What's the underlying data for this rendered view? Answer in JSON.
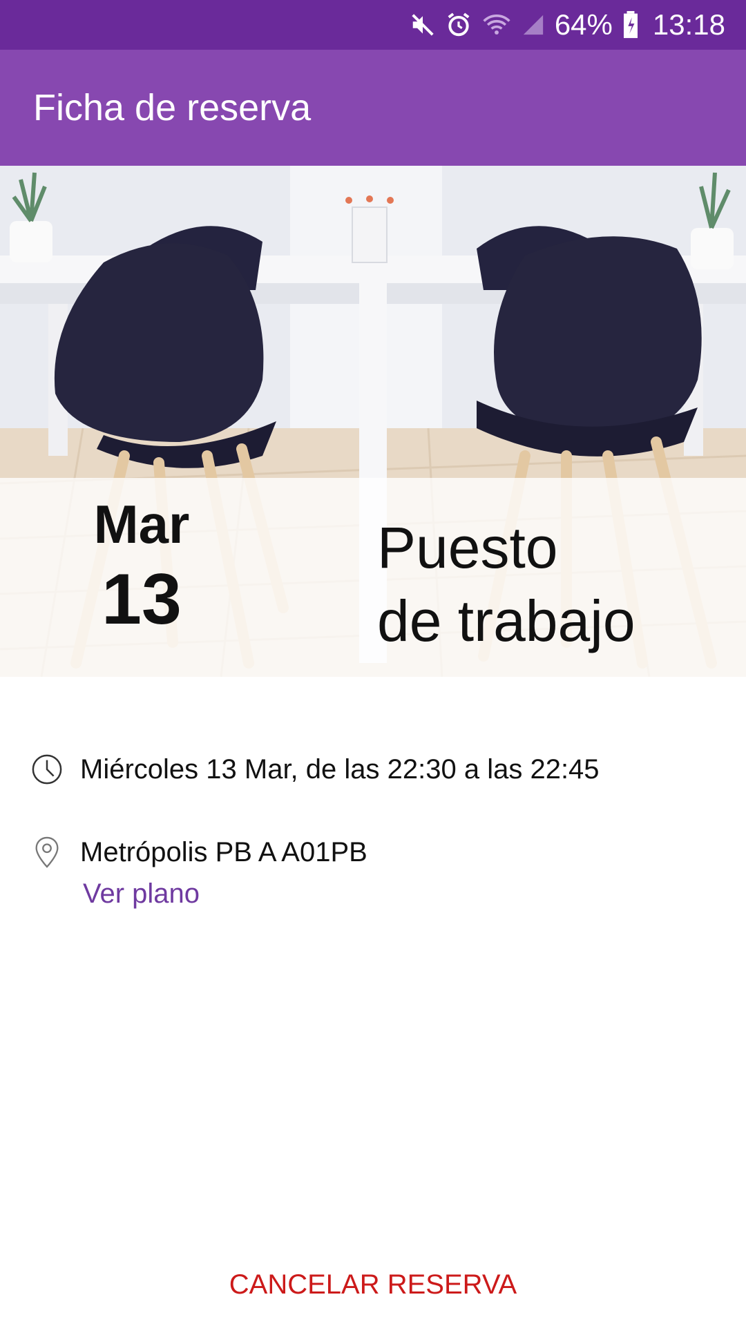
{
  "status_bar": {
    "battery": "64%",
    "time": "13:18",
    "icons": [
      "mute-icon",
      "alarm-icon",
      "wifi-icon",
      "signal-icon",
      "battery-icon"
    ]
  },
  "app_bar": {
    "title": "Ficha de reserva"
  },
  "hero": {
    "weekday": "Mar",
    "day": "13",
    "resource_line1": "Puesto",
    "resource_line2": "de trabajo"
  },
  "details": {
    "time_text": "Miércoles 13 Mar, de las 22:30 a las 22:45",
    "location_text": "Metrópolis PB A A01PB",
    "map_link": "Ver plano"
  },
  "actions": {
    "cancel_label": "CANCELAR RESERVA"
  },
  "colors": {
    "status_bar": "#6a2a9a",
    "app_bar": "#8748b0",
    "link": "#6f3aa0",
    "cancel": "#cc1a1a"
  }
}
